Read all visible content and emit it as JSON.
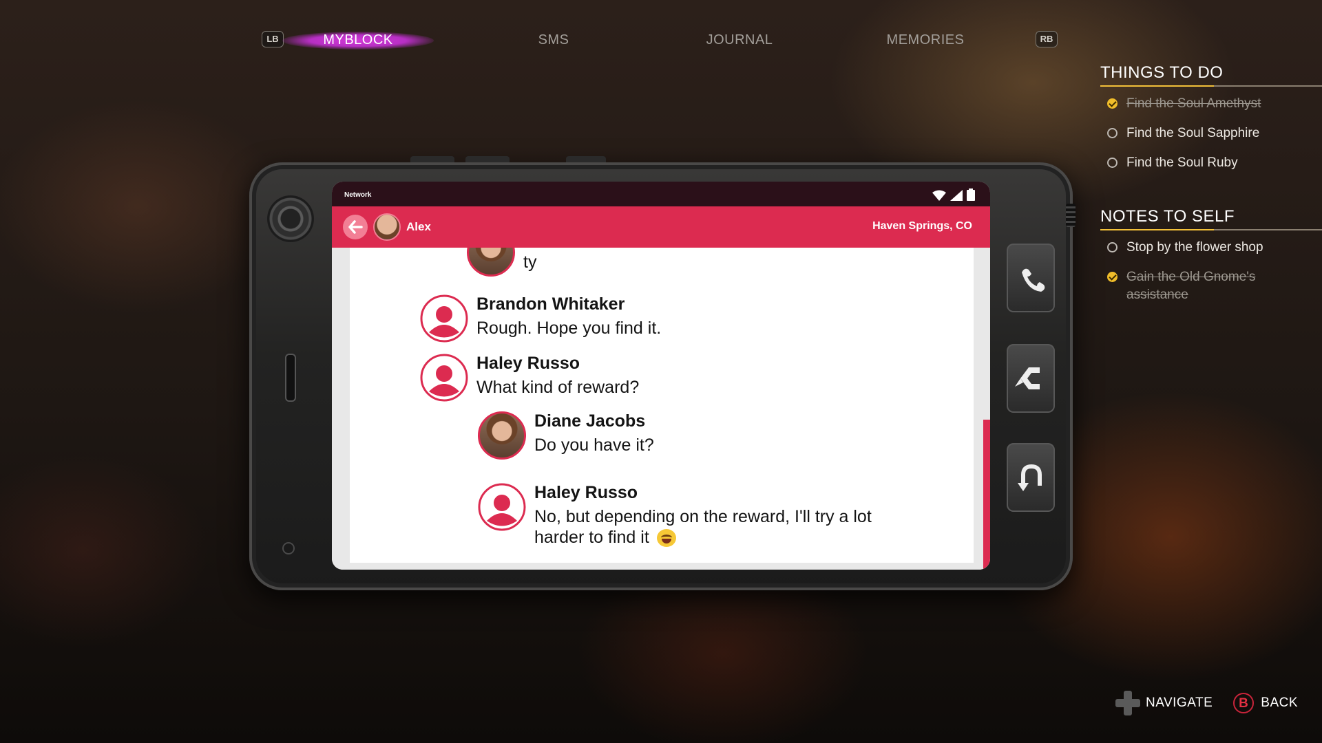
{
  "top_nav": {
    "left_bumper": "LB",
    "right_bumper": "RB",
    "tabs": [
      {
        "label": "MYBLOCK",
        "active": true
      },
      {
        "label": "SMS",
        "active": false
      },
      {
        "label": "JOURNAL",
        "active": false
      },
      {
        "label": "MEMORIES",
        "active": false
      }
    ]
  },
  "phone": {
    "status": {
      "network": "Network"
    },
    "header": {
      "contact_name": "Alex",
      "location": "Haven Springs, CO"
    },
    "messages": [
      {
        "name": "",
        "text": "ty",
        "avatar": "photo"
      },
      {
        "name": "Brandon Whitaker",
        "text": "Rough. Hope you find it.",
        "avatar": "default"
      },
      {
        "name": "Haley Russo",
        "text": "What kind of reward?",
        "avatar": "default"
      },
      {
        "name": "Diane Jacobs",
        "text": "Do you have it?",
        "avatar": "photo"
      },
      {
        "name": "Haley Russo",
        "text": "No, but depending on the reward, I'll try a lot harder to find it",
        "avatar": "default",
        "emoji": "tears-of-joy"
      }
    ],
    "side_buttons": [
      "call-icon",
      "chat-back-icon",
      "return-icon"
    ]
  },
  "things_to_do": {
    "title": "THINGS TO DO",
    "items": [
      {
        "label": "Find the Soul Amethyst",
        "done": true
      },
      {
        "label": "Find the Soul Sapphire",
        "done": false
      },
      {
        "label": "Find the Soul Ruby",
        "done": false
      }
    ]
  },
  "notes_to_self": {
    "title": "NOTES TO SELF",
    "items": [
      {
        "label": "Stop by the flower shop",
        "done": false
      },
      {
        "label": "Gain the Old Gnome's assistance",
        "done": true
      }
    ]
  },
  "hints": {
    "navigate": "NAVIGATE",
    "back_key": "B",
    "back": "BACK"
  },
  "colors": {
    "accent_pink": "#dc2b50",
    "tab_glow": "#c935d0",
    "check_yellow": "#f0bd2a"
  }
}
